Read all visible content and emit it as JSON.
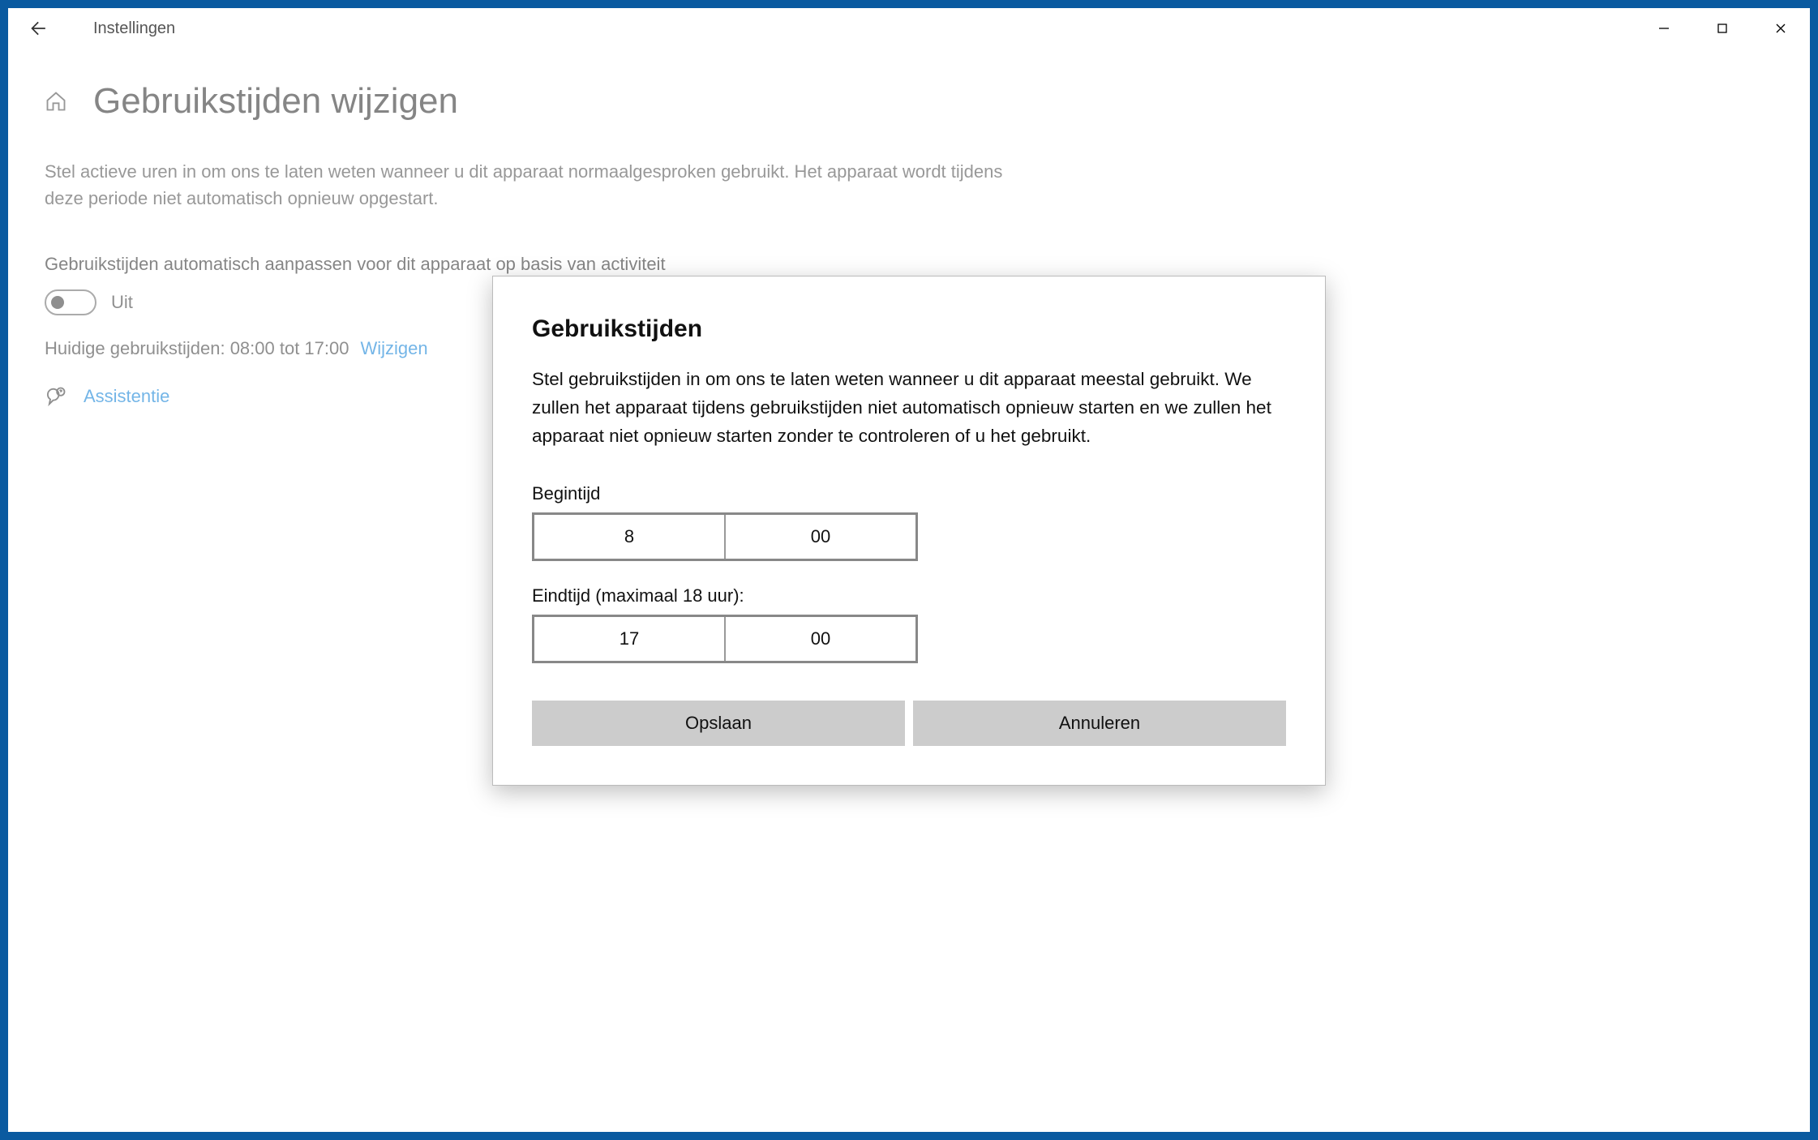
{
  "titlebar": {
    "app_name": "Instellingen"
  },
  "page": {
    "title": "Gebruikstijden wijzigen",
    "description": "Stel actieve uren in om ons te laten weten wanneer u dit apparaat normaalgesproken gebruikt. Het apparaat wordt tijdens deze periode niet automatisch opnieuw opgestart.",
    "auto_adjust_label": "Gebruikstijden automatisch aanpassen voor dit apparaat op basis van activiteit",
    "toggle_state": "Uit",
    "current_hours": "Huidige gebruikstijden: 08:00 tot 17:00",
    "change_link": "Wijzigen",
    "assist_link": "Assistentie"
  },
  "dialog": {
    "title": "Gebruikstijden",
    "description": "Stel gebruikstijden in om ons te laten weten wanneer u dit apparaat meestal gebruikt. We zullen het apparaat tijdens gebruikstijden niet automatisch opnieuw starten en we zullen het apparaat niet opnieuw starten zonder te controleren of u het gebruikt.",
    "start_label": "Begintijd",
    "start_hour": "8",
    "start_minute": "00",
    "end_label": "Eindtijd (maximaal 18 uur):",
    "end_hour": "17",
    "end_minute": "00",
    "save_button": "Opslaan",
    "cancel_button": "Annuleren"
  }
}
